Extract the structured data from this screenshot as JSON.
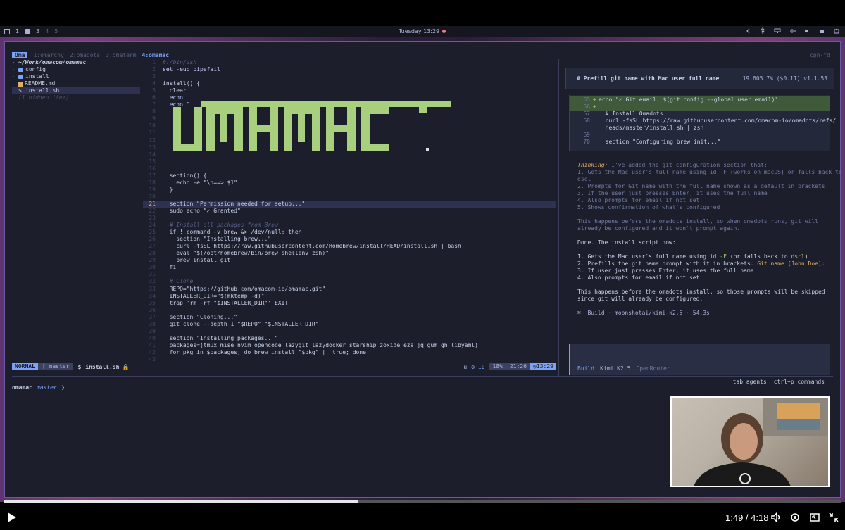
{
  "topbar": {
    "workspaces": [
      "1",
      "3",
      "4",
      "5"
    ],
    "clock": "Tuesday 13:29"
  },
  "tabs": {
    "badge": "Oma",
    "items": [
      "1:omarchy",
      "2:omadots",
      "3:omaterm",
      "4:omamac"
    ],
    "right_label": "cph-fd"
  },
  "filetree": {
    "root": "~/Work/omacom/omamac",
    "items": [
      {
        "name": "config",
        "type": "folder"
      },
      {
        "name": "install",
        "type": "folder"
      },
      {
        "name": "README.md",
        "type": "file"
      },
      {
        "name": "install.sh",
        "type": "script",
        "selected": true
      }
    ],
    "hidden": "(1 hidden item)"
  },
  "editor": {
    "lines": [
      {
        "n": "1",
        "text": "#!/bin/zsh",
        "kind": "comment"
      },
      {
        "n": "2",
        "text": "set -euo pipefail",
        "kind": "kw"
      },
      {
        "n": "3",
        "text": ""
      },
      {
        "n": "4",
        "text": "install() {"
      },
      {
        "n": "5",
        "text": "  clear"
      },
      {
        "n": "6",
        "text": "  echo",
        "kind": "kw"
      },
      {
        "n": "7",
        "text": "  echo \"",
        "kind": "kw"
      },
      {
        "n": "8",
        "text": ""
      },
      {
        "n": "9",
        "text": ""
      },
      {
        "n": "10",
        "text": ""
      },
      {
        "n": "11",
        "text": ""
      },
      {
        "n": "12",
        "text": ""
      },
      {
        "n": "13",
        "text": ""
      },
      {
        "n": "14",
        "text": ""
      },
      {
        "n": "15",
        "text": ""
      },
      {
        "n": "16",
        "text": ""
      },
      {
        "n": "17",
        "text": "  section() {"
      },
      {
        "n": "18",
        "text": "    echo -e \"\\n==> $1\""
      },
      {
        "n": "19",
        "text": "  }"
      },
      {
        "n": "20",
        "text": ""
      },
      {
        "n": "21",
        "text": "  section \"Permission needed for setup...\"",
        "current": true
      },
      {
        "n": "22",
        "text": "  sudo echo \"✓ Granted\""
      },
      {
        "n": "23",
        "text": ""
      },
      {
        "n": "24",
        "text": "  # Install all packages from Brew",
        "kind": "comment"
      },
      {
        "n": "25",
        "text": "  if ! command -v brew &> /dev/null; then"
      },
      {
        "n": "26",
        "text": "    section \"Installing brew...\""
      },
      {
        "n": "27",
        "text": "    curl -fsSL https://raw.githubusercontent.com/Homebrew/install/HEAD/install.sh | bash"
      },
      {
        "n": "28",
        "text": "    eval \"$(/opt/homebrew/bin/brew shellenv zsh)\""
      },
      {
        "n": "29",
        "text": "    brew install git"
      },
      {
        "n": "30",
        "text": "  fi"
      },
      {
        "n": "31",
        "text": ""
      },
      {
        "n": "32",
        "text": "  # Clone",
        "kind": "comment"
      },
      {
        "n": "33",
        "text": "  REPO=\"https://github.com/omacom-io/omamac.git\""
      },
      {
        "n": "34",
        "text": "  INSTALLER_DIR=\"$(mktemp -d)\""
      },
      {
        "n": "35",
        "text": "  trap 'rm -rf \"$INSTALLER_DIR\"' EXIT"
      },
      {
        "n": "36",
        "text": ""
      },
      {
        "n": "37",
        "text": "  section \"Cloning...\""
      },
      {
        "n": "38",
        "text": "  git clone --depth 1 \"$REPO\" \"$INSTALLER_DIR\""
      },
      {
        "n": "39",
        "text": ""
      },
      {
        "n": "40",
        "text": "  section \"Installing packages...\""
      },
      {
        "n": "41",
        "text": "  packages=(tmux mise nvim opencode lazygit lazydocker starship zoxide eza jq gum gh libyaml)"
      },
      {
        "n": "42",
        "text": "  for pkg in $packages; do brew install \"$pkg\" || true; done"
      },
      {
        "n": "43",
        "text": ""
      }
    ]
  },
  "statusline": {
    "mode": "NORMAL",
    "branch": "master",
    "prompt_symbol": "$",
    "file": "install.sh",
    "u": "u",
    "version": "10",
    "percent": "18%",
    "position": "21:26",
    "time": "13:29"
  },
  "agent": {
    "title": "# Prefill git name with Mac user full name",
    "stats": "19,605  7% ($0.11) v1.1.53",
    "diff": [
      {
        "n": "65",
        "sign": "+",
        "text": "echo \"✓ Git email: $(git config --global user.email)\"",
        "added": true
      },
      {
        "n": "66",
        "sign": "+",
        "text": "",
        "added": true
      },
      {
        "n": "67",
        "sign": "",
        "text": "  # Install Omadots"
      },
      {
        "n": "68",
        "sign": "",
        "text": "  curl -fsSL https://raw.githubusercontent.com/omacom-io/omadots/refs/"
      },
      {
        "n": "",
        "sign": "",
        "text": "  heads/master/install.sh | zsh"
      },
      {
        "n": "69",
        "sign": "",
        "text": ""
      },
      {
        "n": "70",
        "sign": "",
        "text": "  section \"Configuring brew init...\""
      }
    ],
    "thinking_label": "Thinking:",
    "thinking_first": " I've added the git configuration section that:",
    "thinking_lines": [
      "1. Gets the Mac user's full name using id -F (works on macOS) or falls back to",
      "dscl",
      "2. Prompts for Git name with the full name shown as a default in brackets",
      "3. If the user just presses Enter, it uses the full name",
      "4. Also prompts for email if not set",
      "5. Shows confirmation of what's configured"
    ],
    "thinking_after": [
      "This happens before the omadots install, so when omadots runs, git will",
      "already be configured and it won't prompt again."
    ],
    "done_line": "Done. The install script now:",
    "done_items": [
      {
        "a": "1. Gets the Mac user's full name using ",
        "b": "id -F",
        "c": " (or falls back to ",
        "d": "dscl",
        "e": ")"
      },
      {
        "a": "2. Prefills the git name prompt with it in brackets: ",
        "b": "Git name [John Doe]",
        "c": ":",
        "d": "",
        "e": ""
      },
      {
        "a": "3. If user just presses Enter, it uses the full name",
        "b": "",
        "c": "",
        "d": "",
        "e": ""
      },
      {
        "a": "4. Also prompts for email if not set",
        "b": "",
        "c": "",
        "d": "",
        "e": ""
      }
    ],
    "final": [
      "This happens before the omadots install, so those prompts will be skipped",
      "since git will already be configured."
    ],
    "build_line": "⌘  Build · moonshotai/kimi-k2.5 · 54.3s",
    "prompt": {
      "mode": "Build",
      "model": "Kimi K2.5",
      "provider": "OpenRouter"
    },
    "hints": [
      "tab agents",
      "ctrl+p commands"
    ]
  },
  "shell": {
    "dir": "omamac",
    "branch": "master",
    "symbol": "❯"
  },
  "player": {
    "time": "1:49 / 4:18",
    "progress": 0.423
  },
  "colors": {
    "accent": "#7aa2f7",
    "green": "#9ece6a",
    "border": "#6c5a9e"
  }
}
